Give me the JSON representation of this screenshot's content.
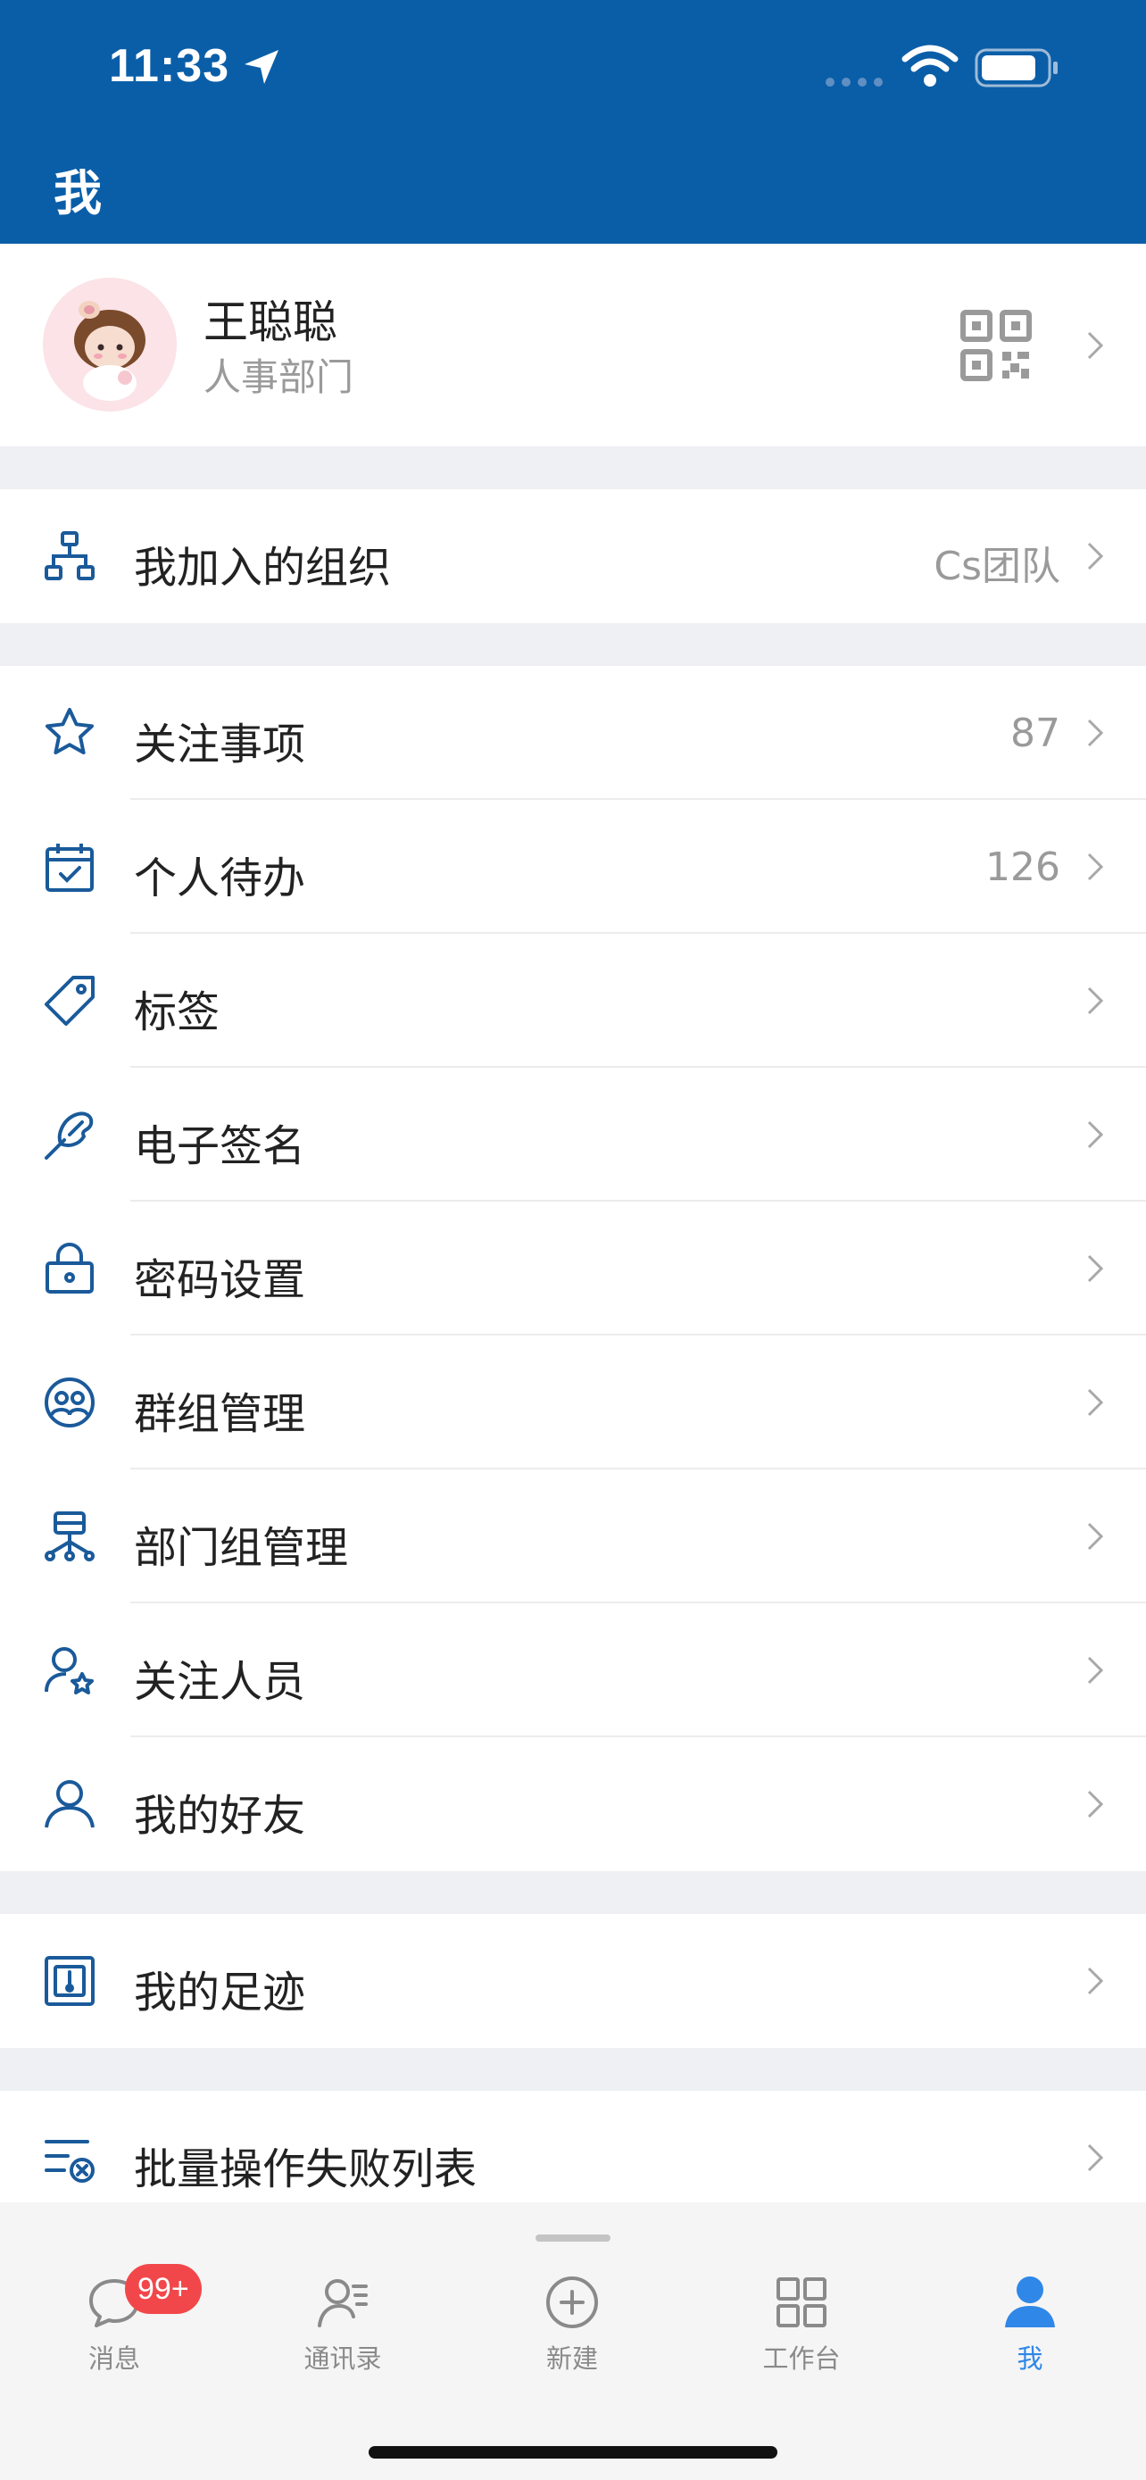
{
  "status_bar": {
    "time": "11:33"
  },
  "header": {
    "title": "我"
  },
  "profile": {
    "name": "王聪聪",
    "department": "人事部门"
  },
  "organization": {
    "label": "我加入的组织",
    "value": "Cs团队"
  },
  "menu": [
    {
      "label": "关注事项",
      "value": "87"
    },
    {
      "label": "个人待办",
      "value": "126"
    },
    {
      "label": "标签"
    },
    {
      "label": "电子签名"
    },
    {
      "label": "密码设置"
    },
    {
      "label": "群组管理"
    },
    {
      "label": "部门组管理"
    },
    {
      "label": "关注人员"
    },
    {
      "label": "我的好友"
    }
  ],
  "footprint": {
    "label": "我的足迹"
  },
  "batch_fail": {
    "label": "批量操作失败列表"
  },
  "tabbar": {
    "badge": "99+",
    "tabs": [
      {
        "label": "消息",
        "icon": "chat-bubble-icon"
      },
      {
        "label": "通讯录",
        "icon": "contacts-icon"
      },
      {
        "label": "新建",
        "icon": "plus-circle-icon"
      },
      {
        "label": "工作台",
        "icon": "grid-icon"
      },
      {
        "label": "我",
        "icon": "person-icon",
        "active": true
      }
    ]
  },
  "colors": {
    "primary": "#0a5ea8",
    "accent": "#2f87e7",
    "badge": "#f2474a",
    "icon": "#1a5a9a"
  }
}
